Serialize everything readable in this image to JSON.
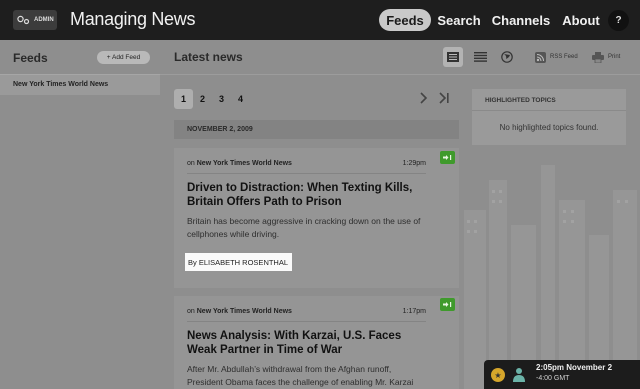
{
  "header": {
    "admin_label": "ADMIN",
    "app_title": "Managing News",
    "nav": [
      {
        "label": "Feeds",
        "active": true
      },
      {
        "label": "Search",
        "active": false
      },
      {
        "label": "Channels",
        "active": false
      },
      {
        "label": "About",
        "active": false
      }
    ],
    "help_label": "?"
  },
  "sidebar": {
    "title": "Feeds",
    "add_button": "+ Add Feed",
    "items": [
      {
        "label": "New York Times World News"
      }
    ]
  },
  "main": {
    "title": "Latest news",
    "tools": {
      "rss_label": "RSS Feed",
      "print_label": "Print"
    },
    "pagination": {
      "pages": [
        "1",
        "2",
        "3",
        "4"
      ],
      "current": "1",
      "next_icon": "chevron-right",
      "last_icon": "last-page"
    },
    "date_header": "NOVEMBER 2, 2009",
    "articles": [
      {
        "on_label": "on",
        "source": "New York Times World News",
        "time": "1:29pm",
        "title": "Driven to Distraction: When Texting Kills, Britain Offers Path to Prison",
        "summary": "Britain has become aggressive in cracking down on the use of cellphones while driving.",
        "byline": "By ELISABETH ROSENTHAL"
      },
      {
        "on_label": "on",
        "source": "New York Times World News",
        "time": "1:17pm",
        "title": "News Analysis: With Karzai, U.S. Faces Weak Partner in Time of War",
        "summary": "After Mr. Abdullah’s withdrawal from the Afghan runoff, President Obama faces the challenge of enabling Mr. Karzai"
      }
    ]
  },
  "highlighted": {
    "title": "HIGHLIGHTED TOPICS",
    "empty_text": "No highlighted topics found."
  },
  "clock": {
    "time": "2:05pm November 2",
    "timezone": "-4:00 GMT"
  },
  "colors": {
    "topbar": "#1e1e1e",
    "overlay_background": "#8e8e8e",
    "share_button": "#3f9a2c",
    "clock_star": "#d6a62b"
  }
}
